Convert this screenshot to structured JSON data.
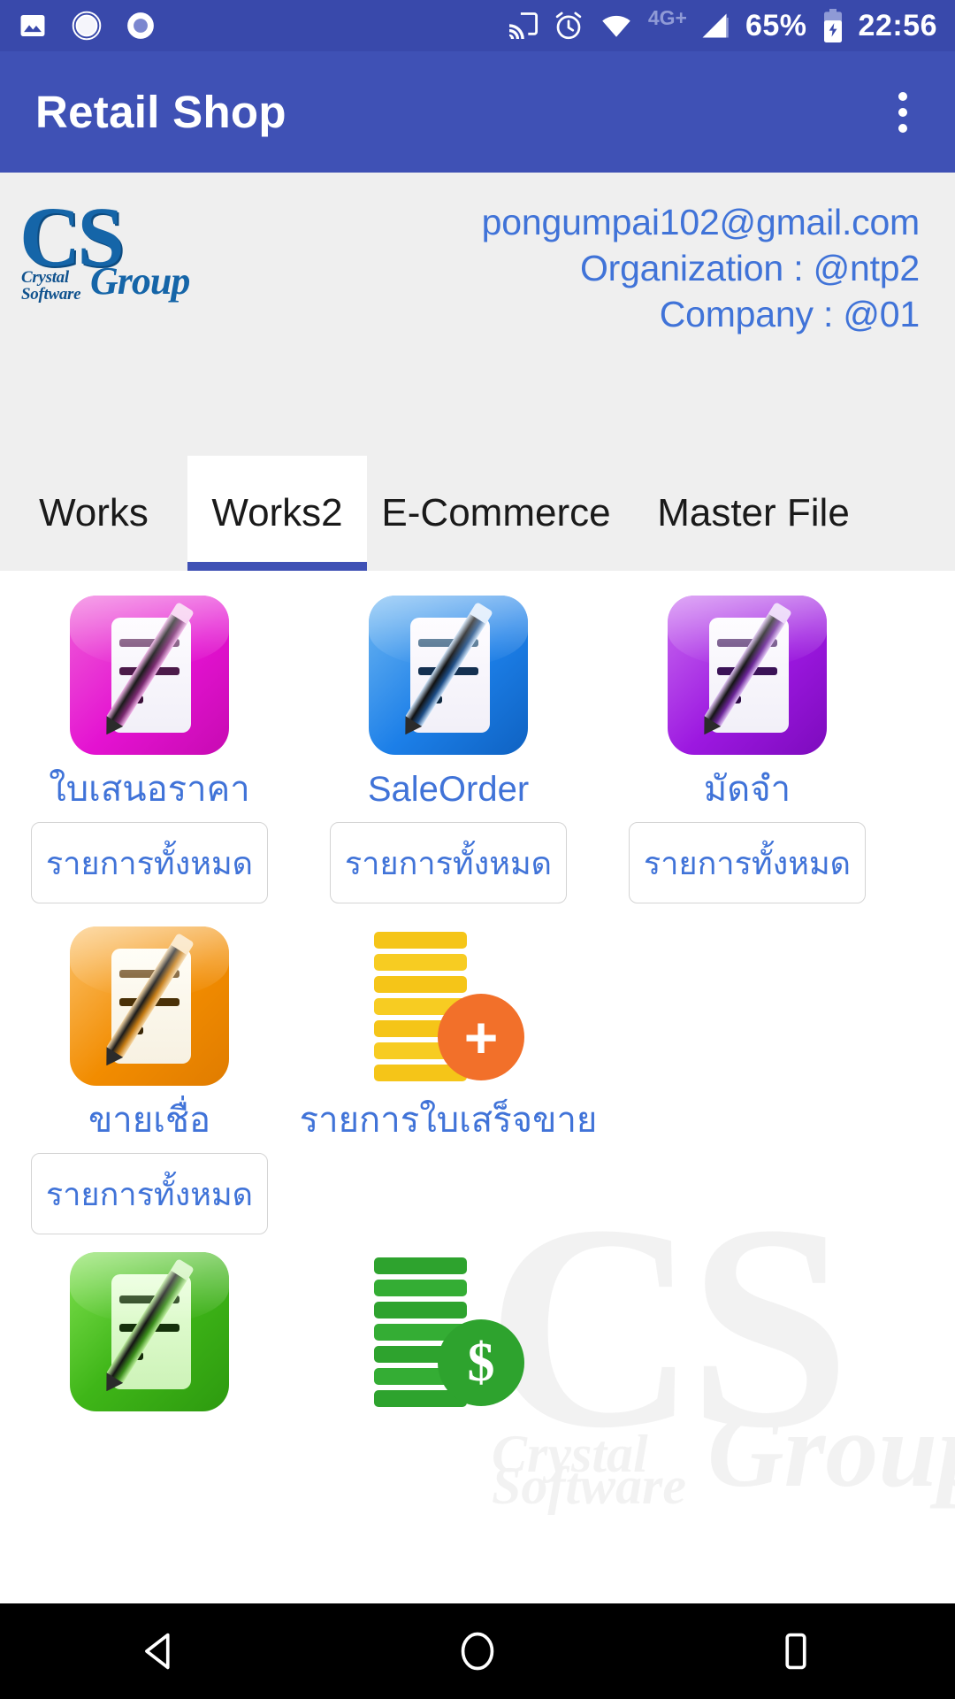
{
  "status_bar": {
    "left_icons": [
      "image-icon",
      "camera-aperture-icon",
      "record-dot-icon"
    ],
    "cast_icon": "cast-icon",
    "alarm_icon": "alarm-clock-icon",
    "wifi_icon": "wifi-icon",
    "network_label": "4G+",
    "signal_icon": "signal-bars-icon",
    "battery_percent": "65%",
    "battery_icon": "battery-charging-icon",
    "clock": "22:56"
  },
  "app_bar": {
    "title": "Retail Shop",
    "overflow_icon": "more-vertical-icon"
  },
  "account": {
    "logo": {
      "mark": "CS",
      "line1": "Crystal",
      "line2": "Software",
      "group": "Group"
    },
    "email": "pongumpai102@gmail.com",
    "organization": "Organization : @ntp2",
    "company": "Company : @01"
  },
  "tabs": {
    "selected_index": 1,
    "items": [
      {
        "label": "Works"
      },
      {
        "label": "Works2"
      },
      {
        "label": "E-Commerce"
      },
      {
        "label": "Master File"
      }
    ]
  },
  "watermark": {
    "mark": "CS",
    "line1": "Crystal",
    "line2": "Software",
    "group": "Group"
  },
  "grid": {
    "all_items_label": "รายการทั้งหมด",
    "rows": [
      [
        {
          "label": "ใบเสนอราคา",
          "icon": "document-edit-icon",
          "color": "#e412d1",
          "has_all_button": true
        },
        {
          "label": "SaleOrder",
          "icon": "document-edit-icon",
          "color": "#1c7fe8",
          "has_all_button": true
        },
        {
          "label": "มัดจำ",
          "icon": "document-edit-icon",
          "color": "#9c18e0",
          "has_all_button": true
        }
      ],
      [
        {
          "label": "ขายเชื่อ",
          "icon": "document-edit-icon",
          "color": "#f28c00",
          "has_all_button": true
        },
        {
          "label": "รายการใบเสร็จขาย",
          "icon": "coin-stack-plus-icon",
          "color": "#f5b400",
          "badge": "+",
          "badge_color": "#f2702a",
          "has_all_button": false
        }
      ],
      [
        {
          "label": "",
          "icon": "document-edit-icon",
          "color": "#3fb618",
          "has_all_button": false
        },
        {
          "label": "",
          "icon": "coin-stack-dollar-icon",
          "color": "#2ea32e",
          "badge": "$",
          "badge_color": "#2ea32e",
          "has_all_button": false
        }
      ]
    ]
  },
  "nav_bar": {
    "back_icon": "back-triangle-icon",
    "home_icon": "home-circle-icon",
    "recents_icon": "recents-square-icon"
  },
  "colors": {
    "status_bar": "#3949ab",
    "app_bar": "#3f51b5",
    "header_bg": "#efefef",
    "accent_text": "#4073d8",
    "tab_indicator": "#3f51b5"
  }
}
